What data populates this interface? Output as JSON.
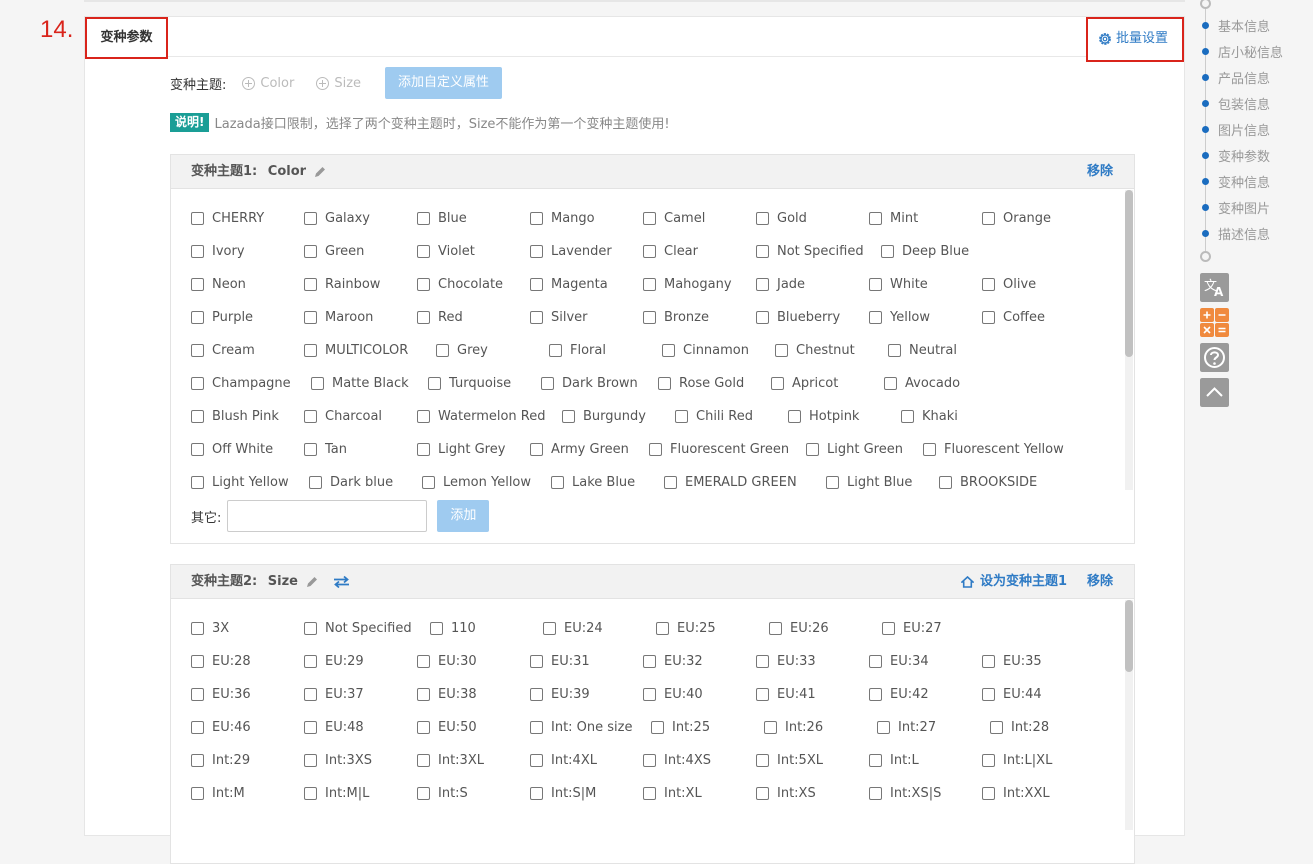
{
  "step_number": "14.",
  "section_title": "变种参数",
  "batch_settings_label": "批量设置",
  "variant_theme": {
    "label": "变种主题:",
    "options": [
      "Color",
      "Size"
    ],
    "add_custom_label": "添加自定义属性"
  },
  "note": {
    "badge": "说明!",
    "text": "Lazada接口限制，选择了两个变种主题时，Size不能作为第一个变种主题使用!"
  },
  "theme1": {
    "prefix": "变种主题1:",
    "name": "Color",
    "remove_label": "移除",
    "rows": [
      [
        "CHERRY",
        "Galaxy",
        "Blue",
        "Mango",
        "Camel",
        "Gold",
        "Mint",
        "Orange"
      ],
      [
        "Ivory",
        "Green",
        "Violet",
        "Lavender",
        "Clear",
        "Not Specified",
        "Deep Blue"
      ],
      [
        "Neon",
        "Rainbow",
        "Chocolate",
        "Magenta",
        "Mahogany",
        "Jade",
        "White",
        "Olive"
      ],
      [
        "Purple",
        "Maroon",
        "Red",
        "Silver",
        "Bronze",
        "Blueberry",
        "Yellow",
        "Coffee"
      ],
      [
        "Cream",
        "MULTICOLOR",
        "Grey",
        "Floral",
        "Cinnamon",
        "Chestnut",
        "Neutral"
      ],
      [
        "Champagne",
        "Matte Black",
        "Turquoise",
        "Dark Brown",
        "Rose Gold",
        "Apricot",
        "Avocado"
      ],
      [
        "Blush Pink",
        "Charcoal",
        "Watermelon Red",
        "Burgundy",
        "Chili Red",
        "Hotpink",
        "Khaki"
      ],
      [
        "Off White",
        "Tan",
        "Light Grey",
        "Army Green",
        "Fluorescent Green",
        "Light Green",
        "Fluorescent Yellow"
      ],
      [
        "Light Yellow",
        "Dark blue",
        "Lemon Yellow",
        "Lake Blue",
        "EMERALD GREEN",
        "Light Blue",
        "BROOKSIDE"
      ]
    ],
    "other_label": "其它:",
    "other_value": "",
    "add_label": "添加"
  },
  "theme2": {
    "prefix": "变种主题2:",
    "name": "Size",
    "set_first_label": "设为变种主题1",
    "remove_label": "移除",
    "rows": [
      [
        "3X",
        "Not Specified",
        "110",
        "EU:24",
        "EU:25",
        "EU:26",
        "EU:27"
      ],
      [
        "EU:28",
        "EU:29",
        "EU:30",
        "EU:31",
        "EU:32",
        "EU:33",
        "EU:34",
        "EU:35"
      ],
      [
        "EU:36",
        "EU:37",
        "EU:38",
        "EU:39",
        "EU:40",
        "EU:41",
        "EU:42",
        "EU:44"
      ],
      [
        "EU:46",
        "EU:48",
        "EU:50",
        "Int: One size",
        "Int:25",
        "Int:26",
        "Int:27",
        "Int:28"
      ],
      [
        "Int:29",
        "Int:3XS",
        "Int:3XL",
        "Int:4XL",
        "Int:4XS",
        "Int:5XL",
        "Int:L",
        "Int:L|XL"
      ],
      [
        "Int:M",
        "Int:M|L",
        "Int:S",
        "Int:S|M",
        "Int:XL",
        "Int:XS",
        "Int:XS|S",
        "Int:XXL"
      ]
    ]
  },
  "right_nav": {
    "items": [
      "基本信息",
      "店小秘信息",
      "产品信息",
      "包装信息",
      "图片信息",
      "变种参数",
      "变种信息",
      "变种图片",
      "描述信息"
    ]
  },
  "colors": {
    "accent_blue": "#2f7bc5",
    "highlight_red": "#d9241b",
    "badge_teal": "#1a9e96",
    "button_light_blue": "#9fcbf0"
  }
}
